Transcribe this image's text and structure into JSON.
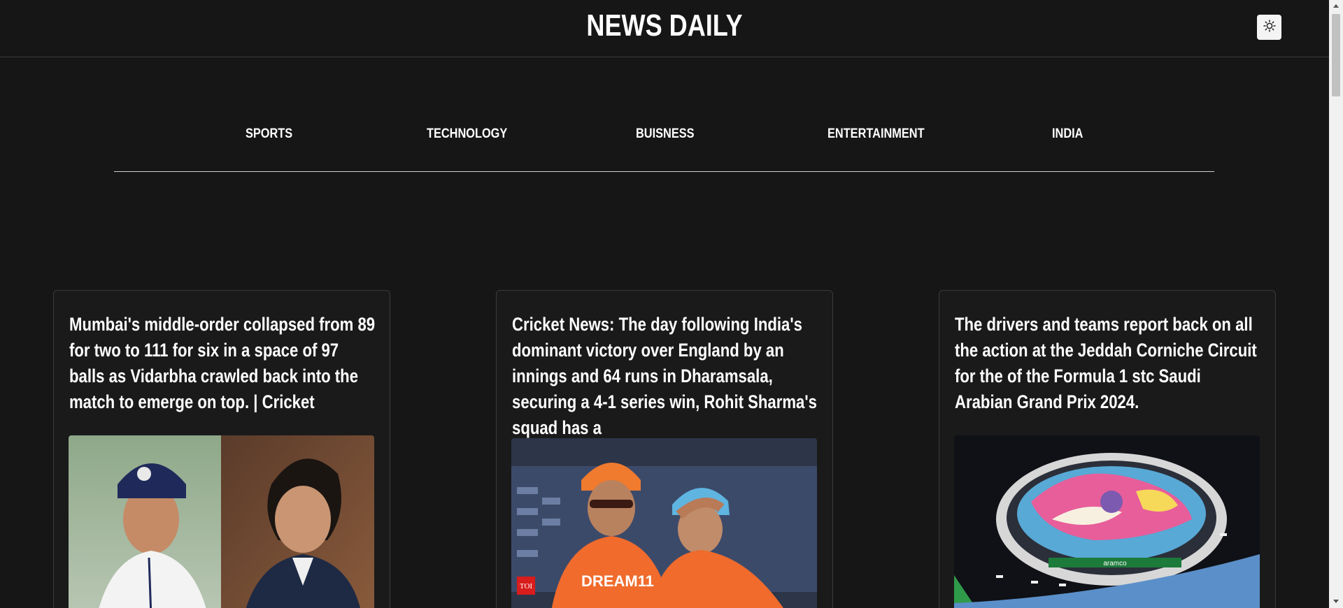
{
  "header": {
    "title": "NEWS DAILY",
    "theme_toggle_icon": "sun-icon"
  },
  "nav": {
    "items": [
      {
        "label": "SPORTS"
      },
      {
        "label": "TECHNOLOGY"
      },
      {
        "label": "BUISNESS"
      },
      {
        "label": "ENTERTAINMENT"
      },
      {
        "label": "INDIA"
      }
    ]
  },
  "articles": [
    {
      "title": "Mumbai's middle-order collapsed from 89 for two to 111 for six in a space of 97 balls as Vidarbha crawled back into the match to emerge on top. | Cricket",
      "image": "cricket-players-photo"
    },
    {
      "title": "Cricket News: The day following India's dominant victory over England by an innings and 64 runs in Dharamsala, securing a 4-1 series win, Rohit Sharma's squad has a",
      "image": "india-team-coaches-photo",
      "image_badge": "TOI",
      "image_sponsor": "DREAM11"
    },
    {
      "title": "The drivers and teams report back on all the action at the Jeddah Corniche Circuit for the of the Formula 1 stc Saudi Arabian Grand Prix 2024.",
      "image": "jeddah-circuit-aerial-photo",
      "image_banner": "aramco"
    }
  ],
  "colors": {
    "background": "#161616",
    "card_background": "#1a1a1a",
    "text": "#ffffff",
    "divider": "#cfcfcf"
  }
}
